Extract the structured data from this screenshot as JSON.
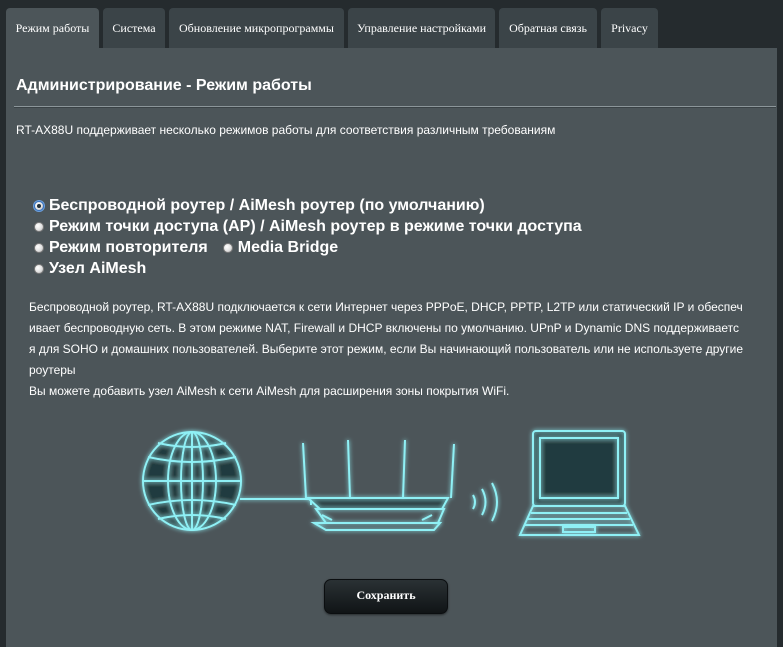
{
  "tabs": [
    {
      "label": "Режим работы",
      "active": true
    },
    {
      "label": "Система",
      "active": false
    },
    {
      "label": "Обновление микропрограммы",
      "active": false
    },
    {
      "label": "Управление настройками",
      "active": false
    },
    {
      "label": "Обратная связь",
      "active": false
    },
    {
      "label": "Privacy",
      "active": false
    }
  ],
  "main": {
    "title": "Администрирование - Режим работы",
    "subtitle": "RT-AX88U поддерживает несколько режимов работы для соответствия различным требованиям",
    "modes": {
      "wireless_router": {
        "label": "Беспроводной роутер / AiMesh роутер (по умолчанию)",
        "checked": true
      },
      "access_point": {
        "label": "Режим точки доступа (AP) / AiMesh роутер в режиме точки доступа",
        "checked": false
      },
      "repeater": {
        "label": "Режим повторителя",
        "checked": false
      },
      "media_bridge": {
        "label": "Media Bridge",
        "checked": false
      },
      "aimesh_node": {
        "label": "Узел AiMesh",
        "checked": false
      }
    },
    "description": "Беспроводной роутер, RT-AX88U подключается к сети Интернет через PPPoE, DHCP, PPTP, L2TP или статический IP и обеспечивает беспроводную сеть. В этом режиме NAT, Firewall и DHCP включены по умолчанию. UPnP и Dynamic DNS поддерживается для SOHO и домашних пользователей. Выберите этот режим, если Вы начинающий пользователь или не используете другие роутеры",
    "description_aimesh": "Вы можете добавить узел AiMesh к сети AiMesh для расширения зоны покрытия WiFi.",
    "illustration_icons": [
      "globe-icon",
      "router-icon",
      "wifi-waves-icon",
      "laptop-icon"
    ],
    "save_label": "Сохранить"
  },
  "colors": {
    "page_bg": "#252b2e",
    "panel_bg": "#4c5559",
    "tab_bg": "#3b4448",
    "glow": "#7fe6ee"
  }
}
